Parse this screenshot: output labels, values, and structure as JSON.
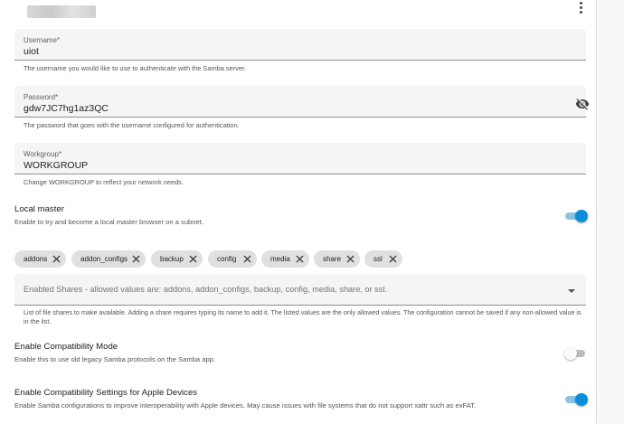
{
  "username": {
    "label": "Username*",
    "value": "uiot",
    "helper": "The username you would like to use to authenticate with the Samba server."
  },
  "password": {
    "label": "Password*",
    "value": "gdw7JC7hg1az3QC",
    "helper": "The password that goes with the username configured for authentication.",
    "icon": "eye-off-icon"
  },
  "workgroup": {
    "label": "Workgroup*",
    "value": "WORKGROUP",
    "helper": "Change WORKGROUP to reflect your network needs."
  },
  "local_master": {
    "title": "Local master",
    "description": "Enable to try and become a local master browser on a subnet.",
    "enabled": true
  },
  "shares": {
    "chips": [
      "addons",
      "addon_configs",
      "backup",
      "config",
      "media",
      "share",
      "ssl"
    ],
    "placeholder": "Enabled Shares - allowed values are: addons, addon_configs, backup, config, media, share, or ssl.",
    "helper": "List of file shares to make available. Adding a share requires typing its name to add it. The listed values are the only allowed values. The configuration cannot be saved if any non-allowed value is in the list."
  },
  "compatibility_mode": {
    "title": "Enable Compatibility Mode",
    "description": "Enable this to use old legacy Samba protocols on the Samba app.",
    "enabled": false
  },
  "apple_compat": {
    "title": "Enable Compatibility Settings for Apple Devices",
    "description": "Enable Samba configurations to improve interoperability with Apple devices. May cause issues with file systems that do not support xattr such as exFAT.",
    "enabled": true
  },
  "colors": {
    "accent": "#0a8ed8",
    "accent_track": "#86c5e6",
    "field_bg": "#f5f5f5",
    "chip_bg": "#e0e0e0"
  }
}
